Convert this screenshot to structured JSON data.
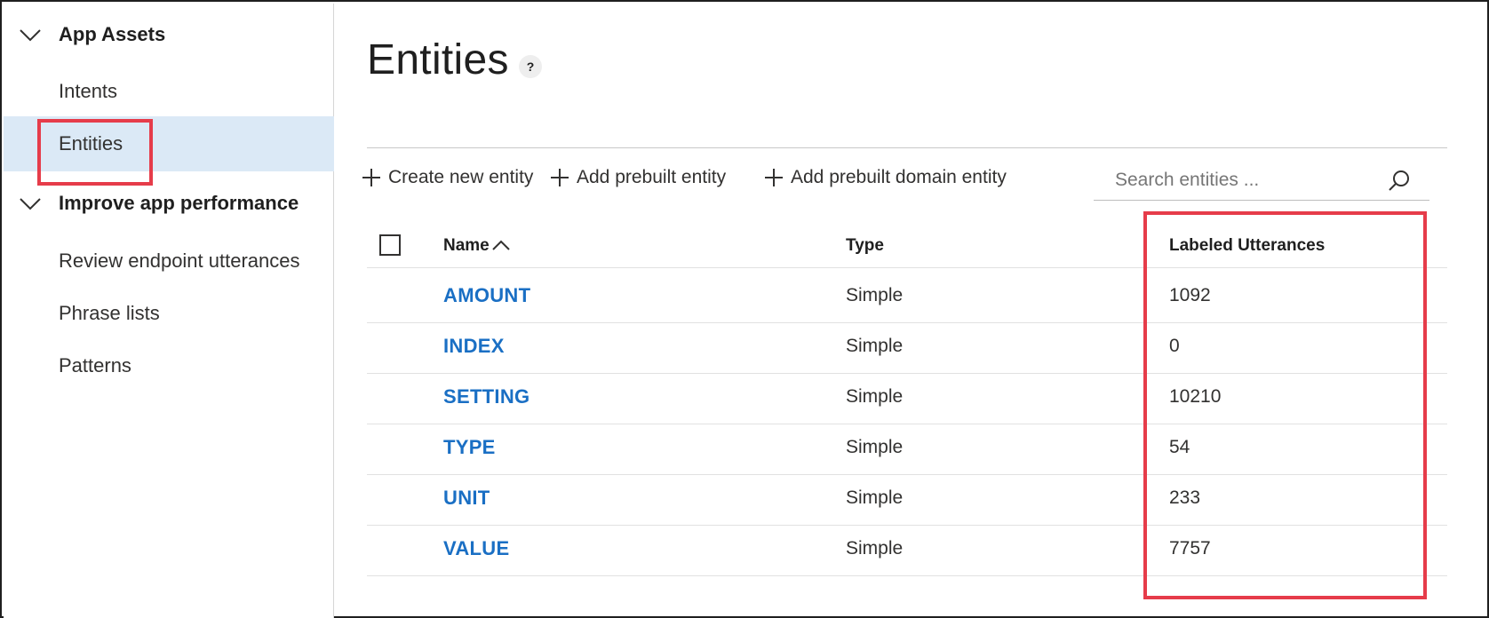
{
  "sidebar": {
    "groups": [
      {
        "label": "App Assets"
      },
      {
        "label": "Improve app performance"
      }
    ],
    "items": [
      {
        "label": "Intents"
      },
      {
        "label": "Entities"
      },
      {
        "label": "Review endpoint utterances"
      },
      {
        "label": "Phrase lists"
      },
      {
        "label": "Patterns"
      }
    ],
    "active_item": "Entities"
  },
  "main": {
    "title": "Entities",
    "help": "?",
    "toolbar": {
      "create": "Create new entity",
      "add_prebuilt": "Add prebuilt entity",
      "add_domain": "Add prebuilt domain entity"
    },
    "search": {
      "placeholder": "Search entities ..."
    },
    "table": {
      "columns": [
        "Name",
        "Type",
        "Labeled Utterances"
      ],
      "sort": "ascending",
      "rows": [
        {
          "name": "AMOUNT",
          "type": "Simple",
          "count": "1092"
        },
        {
          "name": "INDEX",
          "type": "Simple",
          "count": "0"
        },
        {
          "name": "SETTING",
          "type": "Simple",
          "count": "10210"
        },
        {
          "name": "TYPE",
          "type": "Simple",
          "count": "54"
        },
        {
          "name": "UNIT",
          "type": "Simple",
          "count": "233"
        },
        {
          "name": "VALUE",
          "type": "Simple",
          "count": "7757"
        }
      ]
    }
  },
  "colors": {
    "link": "#1a6fc4",
    "active_bg": "#dbe9f6",
    "highlight": "#e63c4a"
  }
}
